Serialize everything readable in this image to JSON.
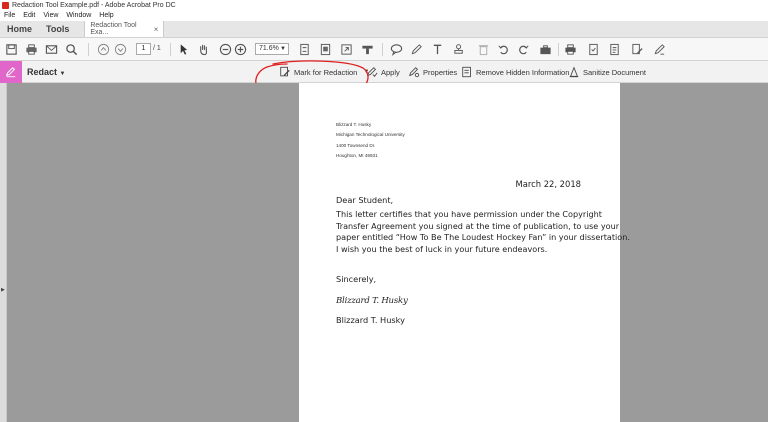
{
  "window": {
    "title": "Redaction Tool Example.pdf - Adobe Acrobat Pro DC"
  },
  "menu": [
    "File",
    "Edit",
    "View",
    "Window",
    "Help"
  ],
  "tabs": {
    "home": "Home",
    "tools": "Tools",
    "document": "Redaction Tool Exa...",
    "close": "×"
  },
  "toolbar": {
    "page_current": "1",
    "page_total": "/ 1",
    "zoom": "71.6%",
    "icons": [
      "save-icon",
      "print-icon",
      "email-icon",
      "search-icon",
      "page-up-icon",
      "page-down-icon",
      "select-arrow-icon",
      "hand-icon",
      "zoom-out-icon",
      "zoom-in-icon",
      "fit-page-icon",
      "scroll-mode-icon",
      "full-screen-icon",
      "highlight-bar-icon",
      "comment-icon",
      "pen-icon",
      "text-icon",
      "stamp-icon",
      "delete-icon",
      "undo-icon",
      "redo-icon",
      "toolbox-icon",
      "print-production-icon",
      "form-icon",
      "certificate-icon",
      "edit-pdf-icon",
      "sign-icon"
    ]
  },
  "redact": {
    "label": "Redact",
    "mark": "Mark for Redaction",
    "apply": "Apply",
    "properties": "Properties",
    "remove_hidden": "Remove Hidden Information",
    "sanitize": "Sanitize Document",
    "accent": "#e066c9",
    "annotation_color": "#e02020"
  },
  "letter": {
    "address": [
      "Blizzard T. Husky",
      "Michigan Technological University",
      "1400 Townsend Dr.",
      "Houghton, MI 49931"
    ],
    "date": "March 22, 2018",
    "salutation": "Dear Student,",
    "body": [
      "This letter certifies that you have permission under the Copyright",
      "Transfer Agreement you signed at the time of publication, to use your",
      "paper entitled “How To Be The Loudest Hockey Fan” in your dissertation.",
      "I wish you the best of luck in your future endeavors."
    ],
    "closing": "Sincerely,",
    "signature": "Blizzard T. Husky",
    "signer": "Blizzard T. Husky"
  }
}
